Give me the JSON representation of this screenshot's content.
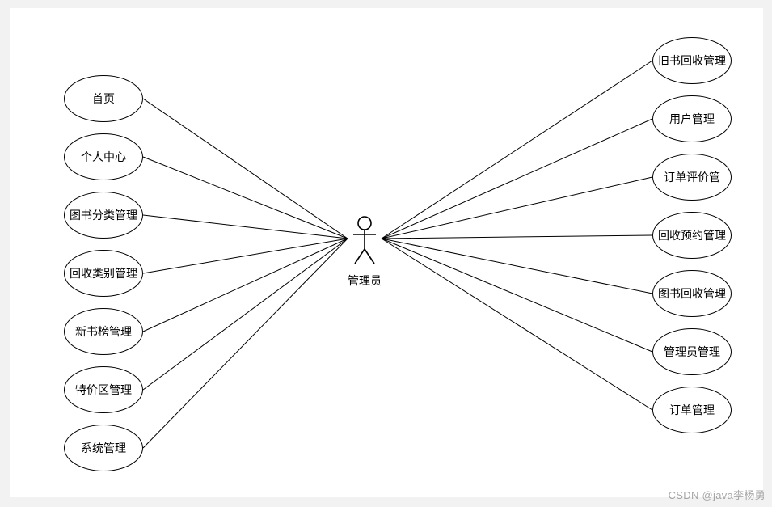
{
  "actor": {
    "label": "管理员"
  },
  "left_usecases": [
    {
      "label": "首页"
    },
    {
      "label": "个人中心"
    },
    {
      "label": "图书分类管理"
    },
    {
      "label": "回收类别管理"
    },
    {
      "label": "新书榜管理"
    },
    {
      "label": "特价区管理"
    },
    {
      "label": "系统管理"
    }
  ],
  "right_usecases": [
    {
      "label": "旧书回收管理"
    },
    {
      "label": "用户管理"
    },
    {
      "label": "订单评价管"
    },
    {
      "label": "回收预约管理"
    },
    {
      "label": "图书回收管理"
    },
    {
      "label": "管理员管理"
    },
    {
      "label": "订单管理"
    }
  ],
  "watermark": "CSDN @java李杨勇",
  "chart_data": {
    "type": "diagram",
    "diagram_type": "uml-use-case",
    "actor": "管理员",
    "use_cases_left": [
      "首页",
      "个人中心",
      "图书分类管理",
      "回收类别管理",
      "新书榜管理",
      "特价区管理",
      "系统管理"
    ],
    "use_cases_right": [
      "旧书回收管理",
      "用户管理",
      "订单评价管",
      "回收预约管理",
      "图书回收管理",
      "管理员管理",
      "订单管理"
    ]
  }
}
